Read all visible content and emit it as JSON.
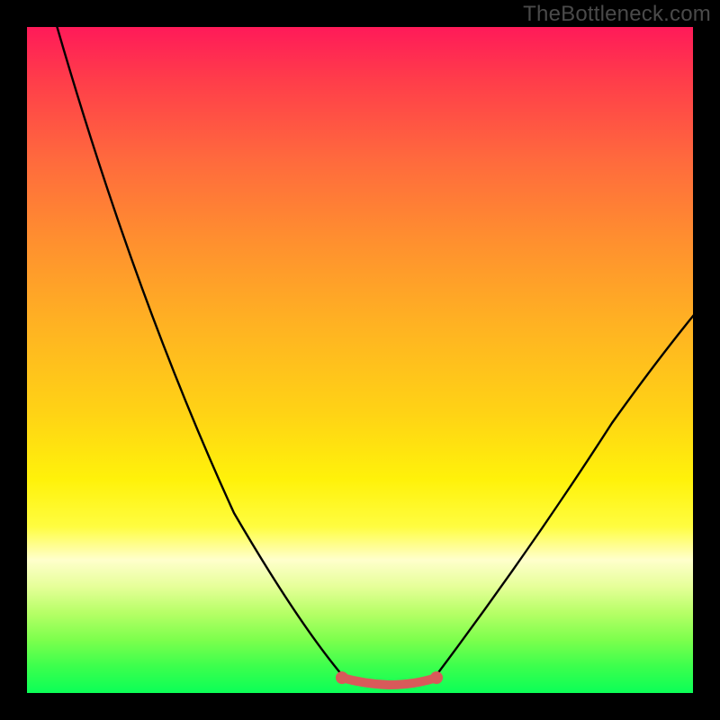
{
  "watermark": "TheBottleneck.com",
  "colors": {
    "frame_border": "#000000",
    "gradient_top": "#ff1a59",
    "gradient_bottom": "#0bff57",
    "curve": "#000000",
    "flat_segment": "#d85a5a"
  },
  "chart_data": {
    "type": "line",
    "title": "",
    "xlabel": "",
    "ylabel": "",
    "xlim": [
      0,
      100
    ],
    "ylim": [
      0,
      100
    ],
    "series": [
      {
        "name": "left-curve",
        "x": [
          5,
          10,
          15,
          20,
          25,
          30,
          35,
          40,
          45,
          48
        ],
        "values": [
          100,
          88,
          76,
          63,
          51,
          39,
          28,
          18,
          8,
          2
        ]
      },
      {
        "name": "flat-segment",
        "x": [
          48,
          50,
          53,
          56,
          59,
          62
        ],
        "values": [
          2,
          1,
          0.8,
          0.8,
          1,
          2
        ]
      },
      {
        "name": "right-curve",
        "x": [
          62,
          66,
          70,
          75,
          80,
          85,
          90,
          95,
          100
        ],
        "values": [
          2,
          6,
          11,
          18,
          25,
          33,
          41,
          49,
          57
        ]
      }
    ],
    "annotations": [
      {
        "type": "dot",
        "x": 48,
        "y": 2
      },
      {
        "type": "dot",
        "x": 62,
        "y": 2
      }
    ]
  }
}
